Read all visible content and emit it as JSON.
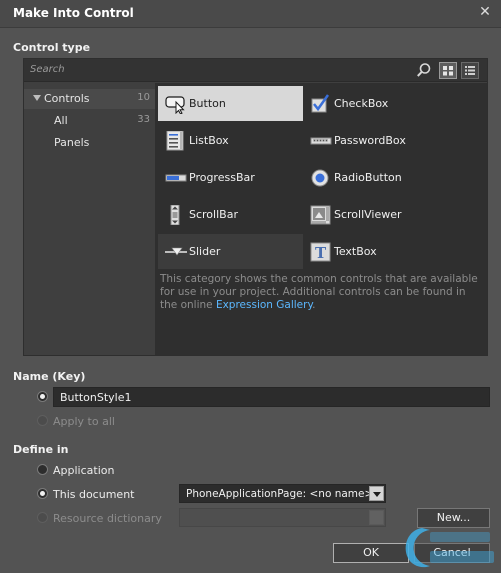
{
  "window": {
    "title": "Make Into Control"
  },
  "control_type": {
    "label": "Control type",
    "search_placeholder": "Search",
    "tree": [
      {
        "label": "Controls",
        "count": "10"
      },
      {
        "label": "All",
        "count": "33"
      },
      {
        "label": "Panels",
        "count": ""
      }
    ],
    "controls": [
      {
        "name": "Button",
        "icon": "button-icon"
      },
      {
        "name": "CheckBox",
        "icon": "checkbox-icon"
      },
      {
        "name": "ListBox",
        "icon": "listbox-icon"
      },
      {
        "name": "PasswordBox",
        "icon": "passwordbox-icon"
      },
      {
        "name": "ProgressBar",
        "icon": "progressbar-icon"
      },
      {
        "name": "RadioButton",
        "icon": "radiobutton-icon"
      },
      {
        "name": "ScrollBar",
        "icon": "scrollbar-icon"
      },
      {
        "name": "ScrollViewer",
        "icon": "scrollviewer-icon"
      },
      {
        "name": "Slider",
        "icon": "slider-icon"
      },
      {
        "name": "TextBox",
        "icon": "textbox-icon"
      }
    ],
    "selected": "Button",
    "description_prefix": "This category shows the common controls that are available for use in your project. Additional controls can be found in the online ",
    "description_link": "Expression Gallery",
    "description_suffix": "."
  },
  "name_key": {
    "label": "Name (Key)",
    "value": "ButtonStyle1",
    "apply_to_all": "Apply to all"
  },
  "define_in": {
    "label": "Define in",
    "application": "Application",
    "this_document": "This document",
    "document_value": "PhoneApplicationPage: <no name>",
    "resource_dictionary": "Resource dictionary",
    "new_button": "New..."
  },
  "footer": {
    "ok": "OK",
    "cancel": "Cancel"
  },
  "colors": {
    "link": "#5cb8ff",
    "background": "#535353",
    "selected_tile": "#d8d8d8"
  }
}
